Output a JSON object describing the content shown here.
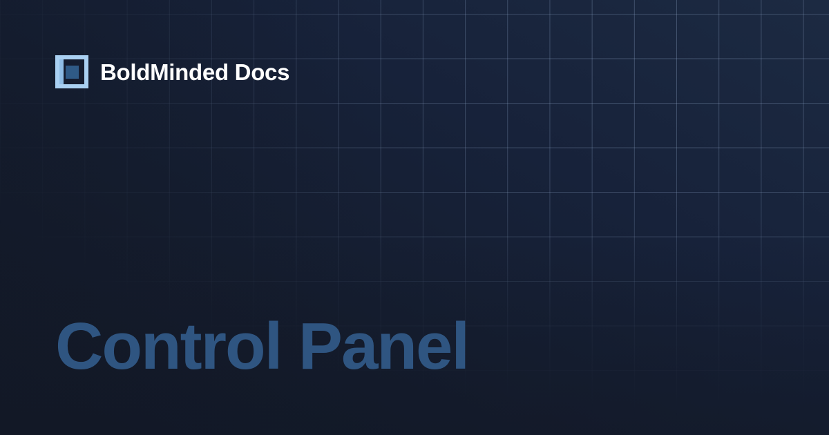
{
  "brand": {
    "name": "BoldMinded Docs",
    "logo_icon": "square-frame-logo-icon"
  },
  "page": {
    "title": "Control Panel"
  },
  "colors": {
    "background": "#141c2d",
    "grid_line": "#a0b9dc",
    "title_text": "#2f5581",
    "brand_text": "#ffffff",
    "logo_light": "#a9d0f2",
    "logo_dark": "#2f5a86"
  }
}
